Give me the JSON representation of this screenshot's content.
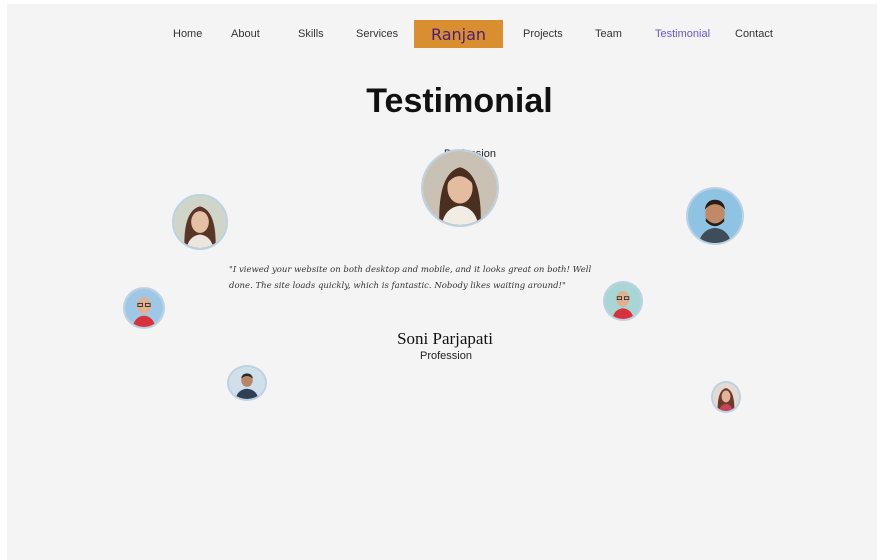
{
  "nav": {
    "items": [
      "Home",
      "About",
      "Skills",
      "Services",
      "Projects",
      "Team",
      "Testimonial",
      "Contact"
    ],
    "brand": "Ranjan",
    "active": "Testimonial"
  },
  "section": {
    "title": "Testimonial"
  },
  "featured": {
    "profession": "Profession"
  },
  "testimonial": {
    "quote": "\"I viewed your website on both desktop and mobile, and it looks great on both! Well done. The site loads quickly, which is fantastic. Nobody likes waiting around!\"",
    "name": "Soni Parjapati",
    "profession": "Profession"
  },
  "colors": {
    "background": "#f5f4f4",
    "brand_bg": "#d98e2f",
    "brand_text": "#4a1e7a",
    "active_nav": "#6a55d8",
    "avatar_border": "#bcd2e2"
  }
}
